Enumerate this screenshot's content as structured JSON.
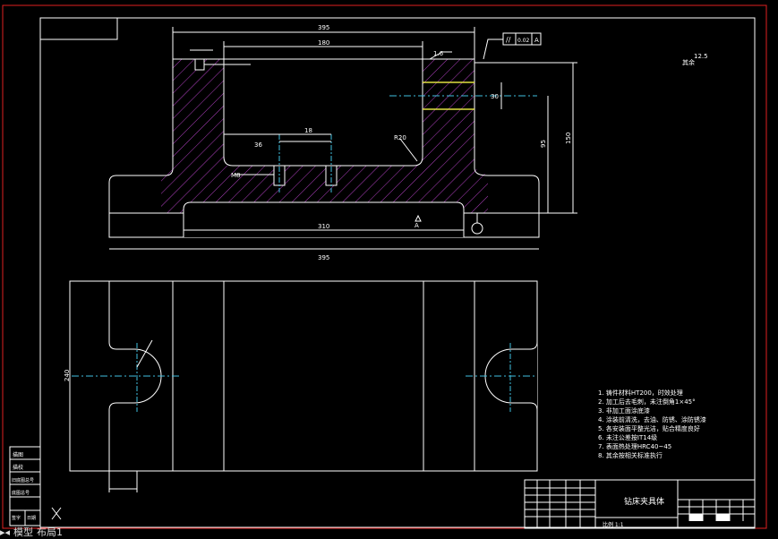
{
  "title_block": {
    "drawing_name": "钻床夹具体",
    "scale_label": "比例 1:1"
  },
  "left_strip": {
    "rows": [
      "描图",
      "描校",
      "旧底图总号",
      "底图总号",
      "签字",
      "日期"
    ]
  },
  "dimensions": {
    "overall_top": "395",
    "inner_top": "180",
    "overall_bottom": "395",
    "bottom_inner": "310",
    "height_right": "150",
    "height_inner": "95",
    "pocket_depth": "30",
    "hole_spacing": "36",
    "slot_width": "18",
    "side_height": "240",
    "radius_label": "R20",
    "thread_label": "M8",
    "datum_label": "A"
  },
  "annotations": {
    "gd_t_symbol": "//",
    "gd_t_value": "0.02",
    "gd_t_datum": "A",
    "finish_top": "1.6",
    "finish_other": "其余",
    "finish_other_val": "12.5"
  },
  "tech_requirements": [
    "1. 铸件材料HT200，时效处理",
    "2. 加工后去毛刺，未注倒角1×45°",
    "3. 非加工面涂底漆",
    "4. 涂装前清洗，去油、防锈、涂防锈漆",
    "5. 各安装面平整光洁，贴合精度良好",
    "6. 未注公差按IT14级",
    "7. 表面热处理HRC40~45",
    "8. 其余按相关标准执行"
  ],
  "tabs": {
    "model": "模型",
    "layout": "布局1"
  },
  "colors": {
    "background": "#000000",
    "line": "#ffffff",
    "hatch": "#b040c0",
    "center": "#40c0e0",
    "border": "#e02020",
    "highlight": "#e0e040"
  }
}
